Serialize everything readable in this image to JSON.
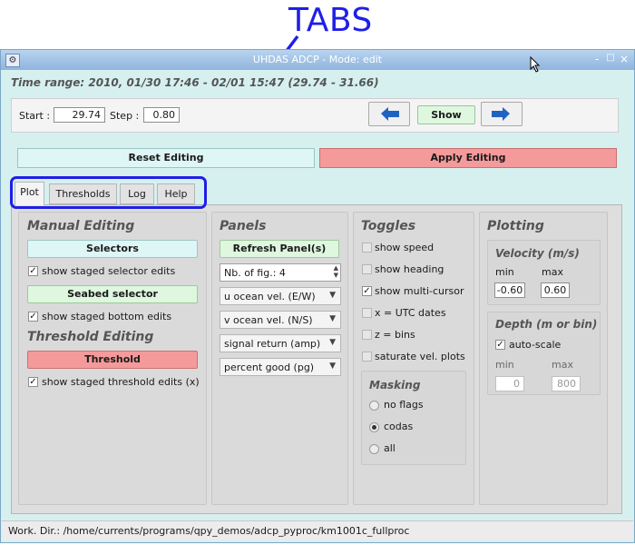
{
  "annotation": {
    "label": "TABS",
    "color": "#1f1fe6"
  },
  "window": {
    "title": "UHDAS ADCP - Mode: edit",
    "controls": [
      "-",
      "□",
      "×"
    ]
  },
  "time_range": "Time range: 2010, 01/30 17:46 - 02/01 15:47 (29.74 - 31.66)",
  "nav": {
    "start_label": "Start :",
    "start_value": "29.74",
    "step_label": "Step :",
    "step_value": "0.80",
    "show_label": "Show"
  },
  "actions": {
    "reset_label": "Reset Editing",
    "apply_label": "Apply Editing"
  },
  "tabs": [
    {
      "label": "Plot",
      "active": true
    },
    {
      "label": "Thresholds",
      "active": false
    },
    {
      "label": "Log",
      "active": false
    },
    {
      "label": "Help",
      "active": false
    }
  ],
  "manual_editing": {
    "heading": "Manual Editing",
    "selectors_button": "Selectors",
    "show_staged_selector": {
      "label": "show staged selector edits",
      "checked": true
    },
    "seabed_button": "Seabed selector",
    "show_staged_bottom": {
      "label": "show staged bottom edits",
      "checked": true
    }
  },
  "threshold_editing": {
    "heading": "Threshold Editing",
    "threshold_button": "Threshold",
    "show_staged_threshold": {
      "label": "show staged threshold edits (x)",
      "checked": true
    }
  },
  "panels": {
    "heading": "Panels",
    "refresh_button": "Refresh Panel(s)",
    "nb_fig": "Nb. of fig.: 4",
    "selects": [
      "u ocean vel. (E/W)",
      "v ocean vel. (N/S)",
      "signal return (amp)",
      "percent good (pg)"
    ]
  },
  "toggles": {
    "heading": "Toggles",
    "items": [
      {
        "label": "show speed",
        "checked": false
      },
      {
        "label": "show heading",
        "checked": false
      },
      {
        "label": "show multi-cursor",
        "checked": true
      },
      {
        "label": "x = UTC dates",
        "checked": false
      },
      {
        "label": "z = bins",
        "checked": false
      },
      {
        "label": "saturate vel. plots",
        "checked": false
      }
    ]
  },
  "masking": {
    "heading": "Masking",
    "options": [
      {
        "label": "no flags",
        "selected": false
      },
      {
        "label": "codas",
        "selected": true
      },
      {
        "label": "all",
        "selected": false
      }
    ]
  },
  "plotting": {
    "heading": "Plotting",
    "velocity": {
      "heading": "Velocity (m/s)",
      "min_label": "min",
      "max_label": "max",
      "min_value": "-0.60",
      "max_value": "0.60"
    },
    "depth": {
      "heading": "Depth (m or bin)",
      "autoscale_label": "auto-scale",
      "autoscale_checked": true,
      "min_label": "min",
      "max_label": "max",
      "min_value": "0",
      "max_value": "800"
    }
  },
  "status": "Work. Dir.: /home/currents/programs/qpy_demos/adcp_pyproc/km1001c_fullproc"
}
